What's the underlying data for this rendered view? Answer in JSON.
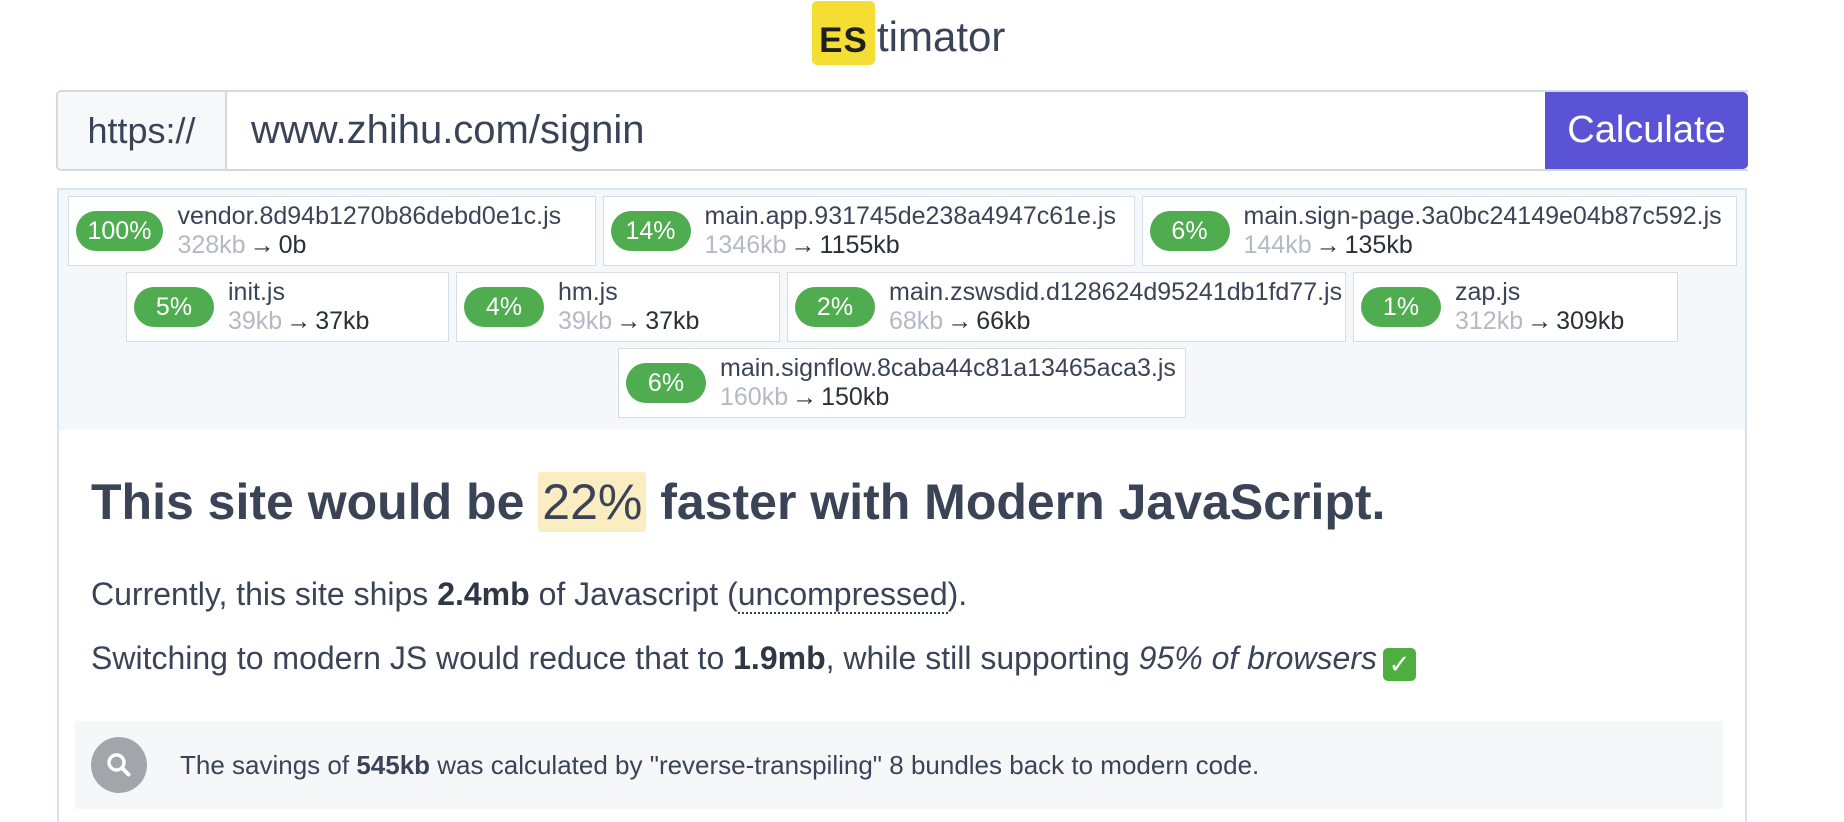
{
  "logo": {
    "badge": "ES",
    "rest": "timator",
    "badge_color": "#f5de34"
  },
  "urlbar": {
    "prefix": "https://",
    "value": "www.zhihu.com/signin",
    "button_label": "Calculate",
    "button_color": "#5a53d6"
  },
  "bundles": [
    {
      "pct": "100%",
      "name": "vendor.8d94b1270b86debd0e1c.js",
      "before": "328kb",
      "after": "0b"
    },
    {
      "pct": "14%",
      "name": "main.app.931745de238a4947c61e.js",
      "before": "1346kb",
      "after": "1155kb"
    },
    {
      "pct": "6%",
      "name": "main.sign-page.3a0bc24149e04b87c592.js",
      "before": "144kb",
      "after": "135kb"
    },
    {
      "pct": "5%",
      "name": "init.js",
      "before": "39kb",
      "after": "37kb"
    },
    {
      "pct": "4%",
      "name": "hm.js",
      "before": "39kb",
      "after": "37kb"
    },
    {
      "pct": "2%",
      "name": "main.zswsdid.d128624d95241db1fd77.js",
      "before": "68kb",
      "after": "66kb"
    },
    {
      "pct": "1%",
      "name": "zap.js",
      "before": "312kb",
      "after": "309kb"
    },
    {
      "pct": "6%",
      "name": "main.signflow.8caba44c81a13465aca3.js",
      "before": "160kb",
      "after": "150kb"
    }
  ],
  "arrow": "→",
  "summary": {
    "headline_pre": "This site would be ",
    "headline_pct": "22%",
    "headline_post": " faster with Modern JavaScript.",
    "line1_pre": "Currently, this site ships ",
    "line1_size": "2.4mb",
    "line1_mid": " of Javascript (",
    "line1_term": "uncompressed",
    "line1_post": ").",
    "line2_pre": "Switching to modern JS would reduce that to ",
    "line2_size": "1.9mb",
    "line2_mid": ", while still supporting ",
    "line2_em": "95% of browsers",
    "line2_check": "✓"
  },
  "note": {
    "pre": "The savings of ",
    "amount": "545kb",
    "post": " was calculated by \"reverse-transpiling\" 8 bundles back to modern code."
  },
  "colors": {
    "badge_green": "#4fad50",
    "highlight": "#fbedc2"
  }
}
